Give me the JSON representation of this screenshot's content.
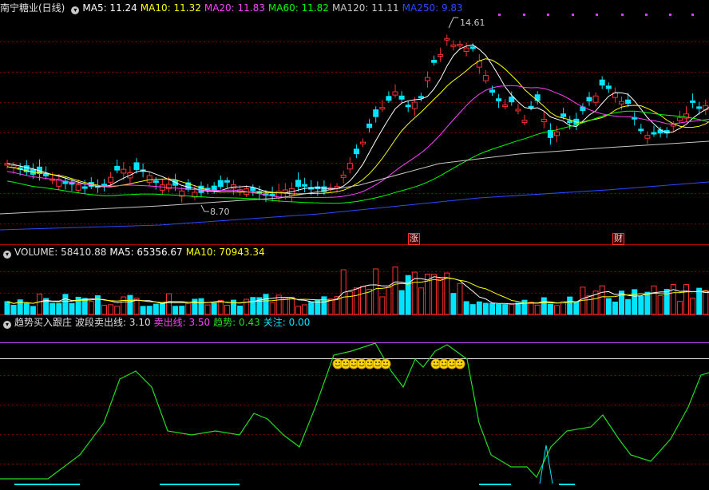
{
  "main": {
    "title": "南宁糖业(日线)",
    "collapse_icon": "chevron-down-icon",
    "ma": [
      {
        "label": "MA5: 11.24",
        "color": "#ffffff"
      },
      {
        "label": "MA10: 11.32",
        "color": "#ffff00"
      },
      {
        "label": "MA20: 11.83",
        "color": "#ff40ff"
      },
      {
        "label": "MA60: 11.82",
        "color": "#00ff00"
      },
      {
        "label": "MA120: 11.11",
        "color": "#c8c8c8"
      },
      {
        "label": "MA250: 9.83",
        "color": "#2a4bff"
      }
    ],
    "high_label": "14.61",
    "low_label": "8.70",
    "tag_up": "涨",
    "tag_fin": "财"
  },
  "volume": {
    "title": "VOLUME: 58410.88",
    "ma5": "MA5: 65356.67",
    "ma10": "MA10: 70943.34"
  },
  "indicator": {
    "title": "趋势买入跟庄",
    "wave": "波段卖出线: 3.10",
    "sell": "卖出线: 3.50",
    "trend": "趋势: 0.43",
    "watch": "关注: 0.00",
    "smile_icon": "smiley-icon"
  },
  "colors": {
    "up": "#ff3030",
    "down": "#00e5ff",
    "background": "#000000",
    "grid": "#8b0000",
    "trend_line": "#22dd22"
  }
}
